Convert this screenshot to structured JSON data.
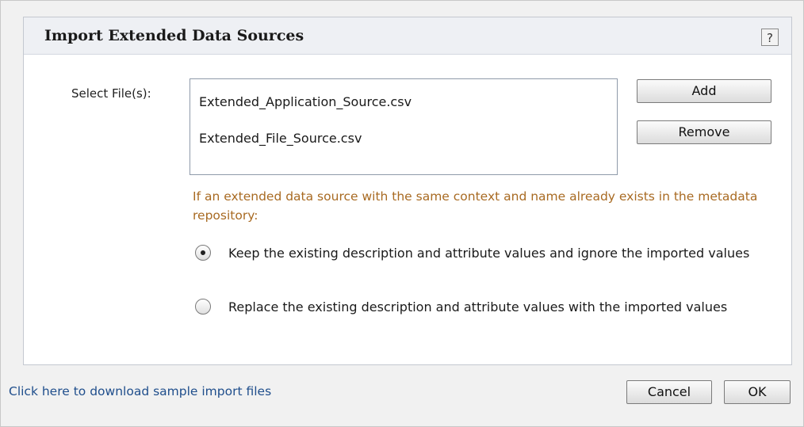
{
  "dialog": {
    "title": "Import Extended Data Sources",
    "help_label": "?"
  },
  "form": {
    "select_label": "Select File(s):",
    "files": [
      "Extended_Application_Source.csv",
      "Extended_File_Source.csv"
    ],
    "add_label": "Add",
    "remove_label": "Remove",
    "notice": "If an extended data source with the same context and name already exists in the metadata repository:",
    "options": [
      {
        "label": "Keep the existing description and attribute values and ignore the imported values",
        "selected": true
      },
      {
        "label": "Replace the existing description and attribute values with the imported values",
        "selected": false
      }
    ]
  },
  "footer": {
    "download_link": "Click here to download sample import files",
    "cancel_label": "Cancel",
    "ok_label": "OK"
  },
  "colors": {
    "notice_text": "#a86a22",
    "link_text": "#1f4e8c",
    "header_bg": "#eef0f4"
  }
}
